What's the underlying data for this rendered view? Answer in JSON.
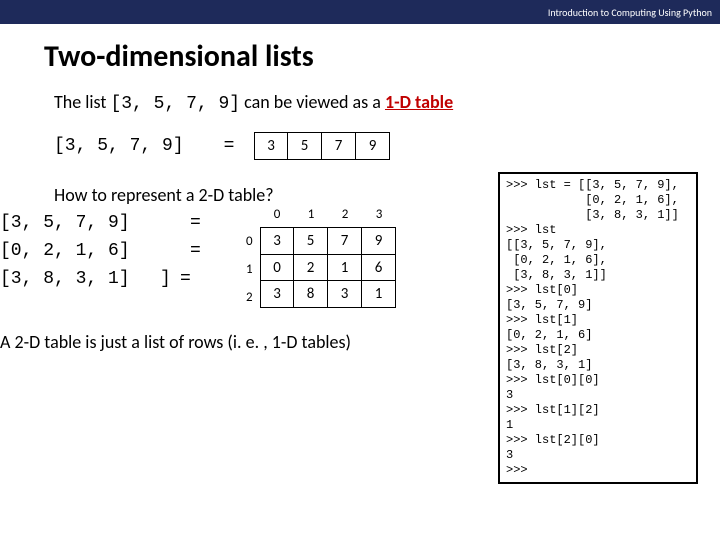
{
  "topbar": "Introduction to Computing Using Python",
  "title": "Two-dimensional lists",
  "intro": {
    "pre": "The list ",
    "code": "[3, 5, 7, 9]",
    "mid": " can be viewed as a ",
    "link": "1-D table"
  },
  "row1": {
    "code": "[3, 5, 7, 9]",
    "eq": "=",
    "cells": [
      "3",
      "5",
      "7",
      "9"
    ]
  },
  "sub": "How to represent a 2-D table?",
  "idx_cols": [
    "0",
    "1",
    "2",
    "3"
  ],
  "idx_rows": [
    "0",
    "1",
    "2"
  ],
  "grid": [
    [
      "3",
      "5",
      "7",
      "9"
    ],
    [
      "0",
      "2",
      "1",
      "6"
    ],
    [
      "3",
      "8",
      "3",
      "1"
    ]
  ],
  "rows_left": {
    "lbr": "[",
    "r0": "[3, 5, 7, 9]",
    "r1": "[0, 2, 1, 6]",
    "r2": "[3, 8, 3, 1]",
    "rbr": "]",
    "eq0": "=",
    "eq1": "=",
    "eq2": "="
  },
  "footer": "A 2-D table is just a list of rows (i. e. , 1-D tables)",
  "repl": ">>> lst = [[3, 5, 7, 9],\n           [0, 2, 1, 6],\n           [3, 8, 3, 1]]\n>>> lst\n[[3, 5, 7, 9],\n [0, 2, 1, 6],\n [3, 8, 3, 1]]\n>>> lst[0]\n[3, 5, 7, 9]\n>>> lst[1]\n[0, 2, 1, 6]\n>>> lst[2]\n[3, 8, 3, 1]\n>>> lst[0][0]\n3\n>>> lst[1][2]\n1\n>>> lst[2][0]\n3\n>>>",
  "chart_data": {
    "type": "table",
    "title": "Two-dimensional lists",
    "oned_list": [
      3,
      5,
      7,
      9
    ],
    "twod_list": [
      [
        3,
        5,
        7,
        9
      ],
      [
        0,
        2,
        1,
        6
      ],
      [
        3,
        8,
        3,
        1
      ]
    ],
    "repl_io": [
      {
        "in": "lst = [[3, 5, 7, 9], [0, 2, 1, 6], [3, 8, 3, 1]]",
        "out": null
      },
      {
        "in": "lst",
        "out": "[[3, 5, 7, 9], [0, 2, 1, 6], [3, 8, 3, 1]]"
      },
      {
        "in": "lst[0]",
        "out": "[3, 5, 7, 9]"
      },
      {
        "in": "lst[1]",
        "out": "[0, 2, 1, 6]"
      },
      {
        "in": "lst[2]",
        "out": "[3, 8, 3, 1]"
      },
      {
        "in": "lst[0][0]",
        "out": "3"
      },
      {
        "in": "lst[1][2]",
        "out": "1"
      },
      {
        "in": "lst[2][0]",
        "out": "3"
      }
    ]
  }
}
